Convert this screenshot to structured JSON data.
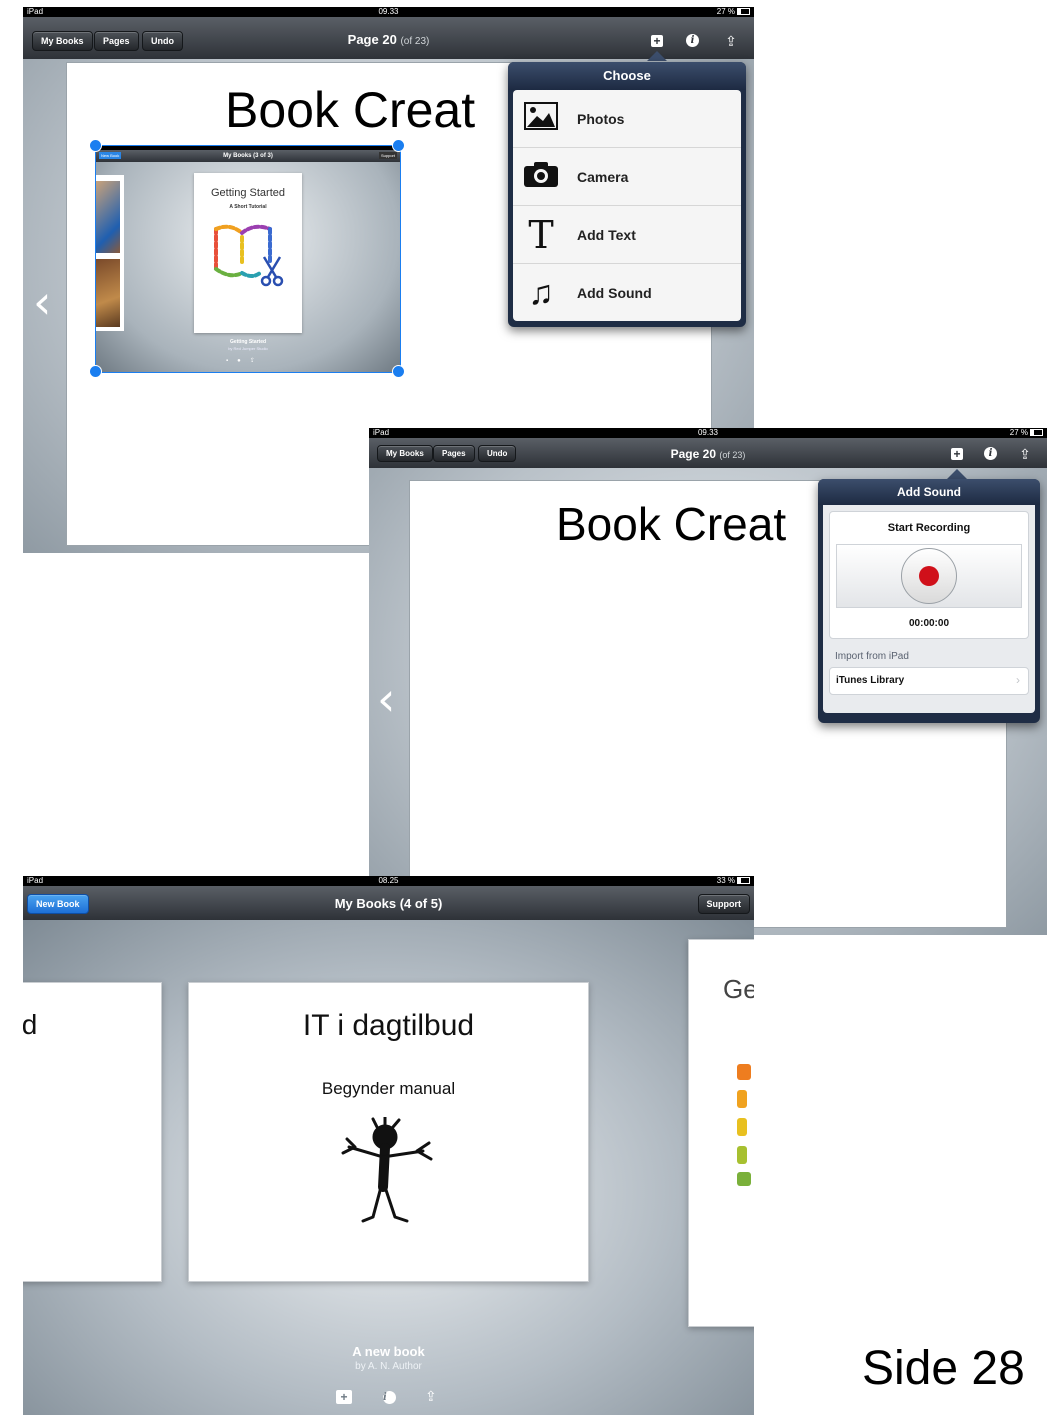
{
  "shot1": {
    "status": {
      "carrier": "iPad",
      "time": "09.33",
      "battery": "27 %"
    },
    "toolbar": {
      "my_books": "My Books",
      "pages": "Pages",
      "undo": "Undo",
      "page_label": "Page 20",
      "page_of": "(of 23)"
    },
    "page_title": "Book Creat",
    "thumbnail": {
      "toolbar_left": "New Book",
      "toolbar_title": "My Books (3 of 3)",
      "toolbar_right": "Support",
      "book_title": "Getting Started",
      "book_subtitle": "A Short Tutorial",
      "caption_title": "Getting Started",
      "caption_author": "by Red Jumper Studio"
    },
    "popover": {
      "title": "Choose",
      "items": [
        {
          "label": "Photos",
          "icon": "photos-icon"
        },
        {
          "label": "Camera",
          "icon": "camera-icon"
        },
        {
          "label": "Add Text",
          "icon": "text-icon"
        },
        {
          "label": "Add Sound",
          "icon": "music-note-icon"
        }
      ]
    }
  },
  "shot2": {
    "status": {
      "carrier": "iPad",
      "time": "09.33",
      "battery": "27 %"
    },
    "toolbar": {
      "my_books": "My Books",
      "pages": "Pages",
      "undo": "Undo",
      "page_label": "Page 20",
      "page_of": "(of 23)"
    },
    "page_title": "Book Creat",
    "popover": {
      "title": "Add Sound",
      "start_recording": "Start Recording",
      "timer": "00:00:00",
      "import_label": "Import from iPad",
      "itunes": "iTunes Library"
    }
  },
  "shot3": {
    "status": {
      "carrier": "iPad",
      "time": "08.25",
      "battery": "33 %"
    },
    "toolbar": {
      "new_book": "New Book",
      "title": "My Books (4 of 5)",
      "support": "Support"
    },
    "left_book_fragment": "ıd",
    "left_book_fragment2": ".l",
    "center_book": {
      "title": "IT i dagtilbud",
      "subtitle": "Begynder manual"
    },
    "right_book_fragment": "Ge",
    "caption": {
      "title": "A new book",
      "author": "by A. N. Author"
    }
  },
  "side_label": "Side 28"
}
